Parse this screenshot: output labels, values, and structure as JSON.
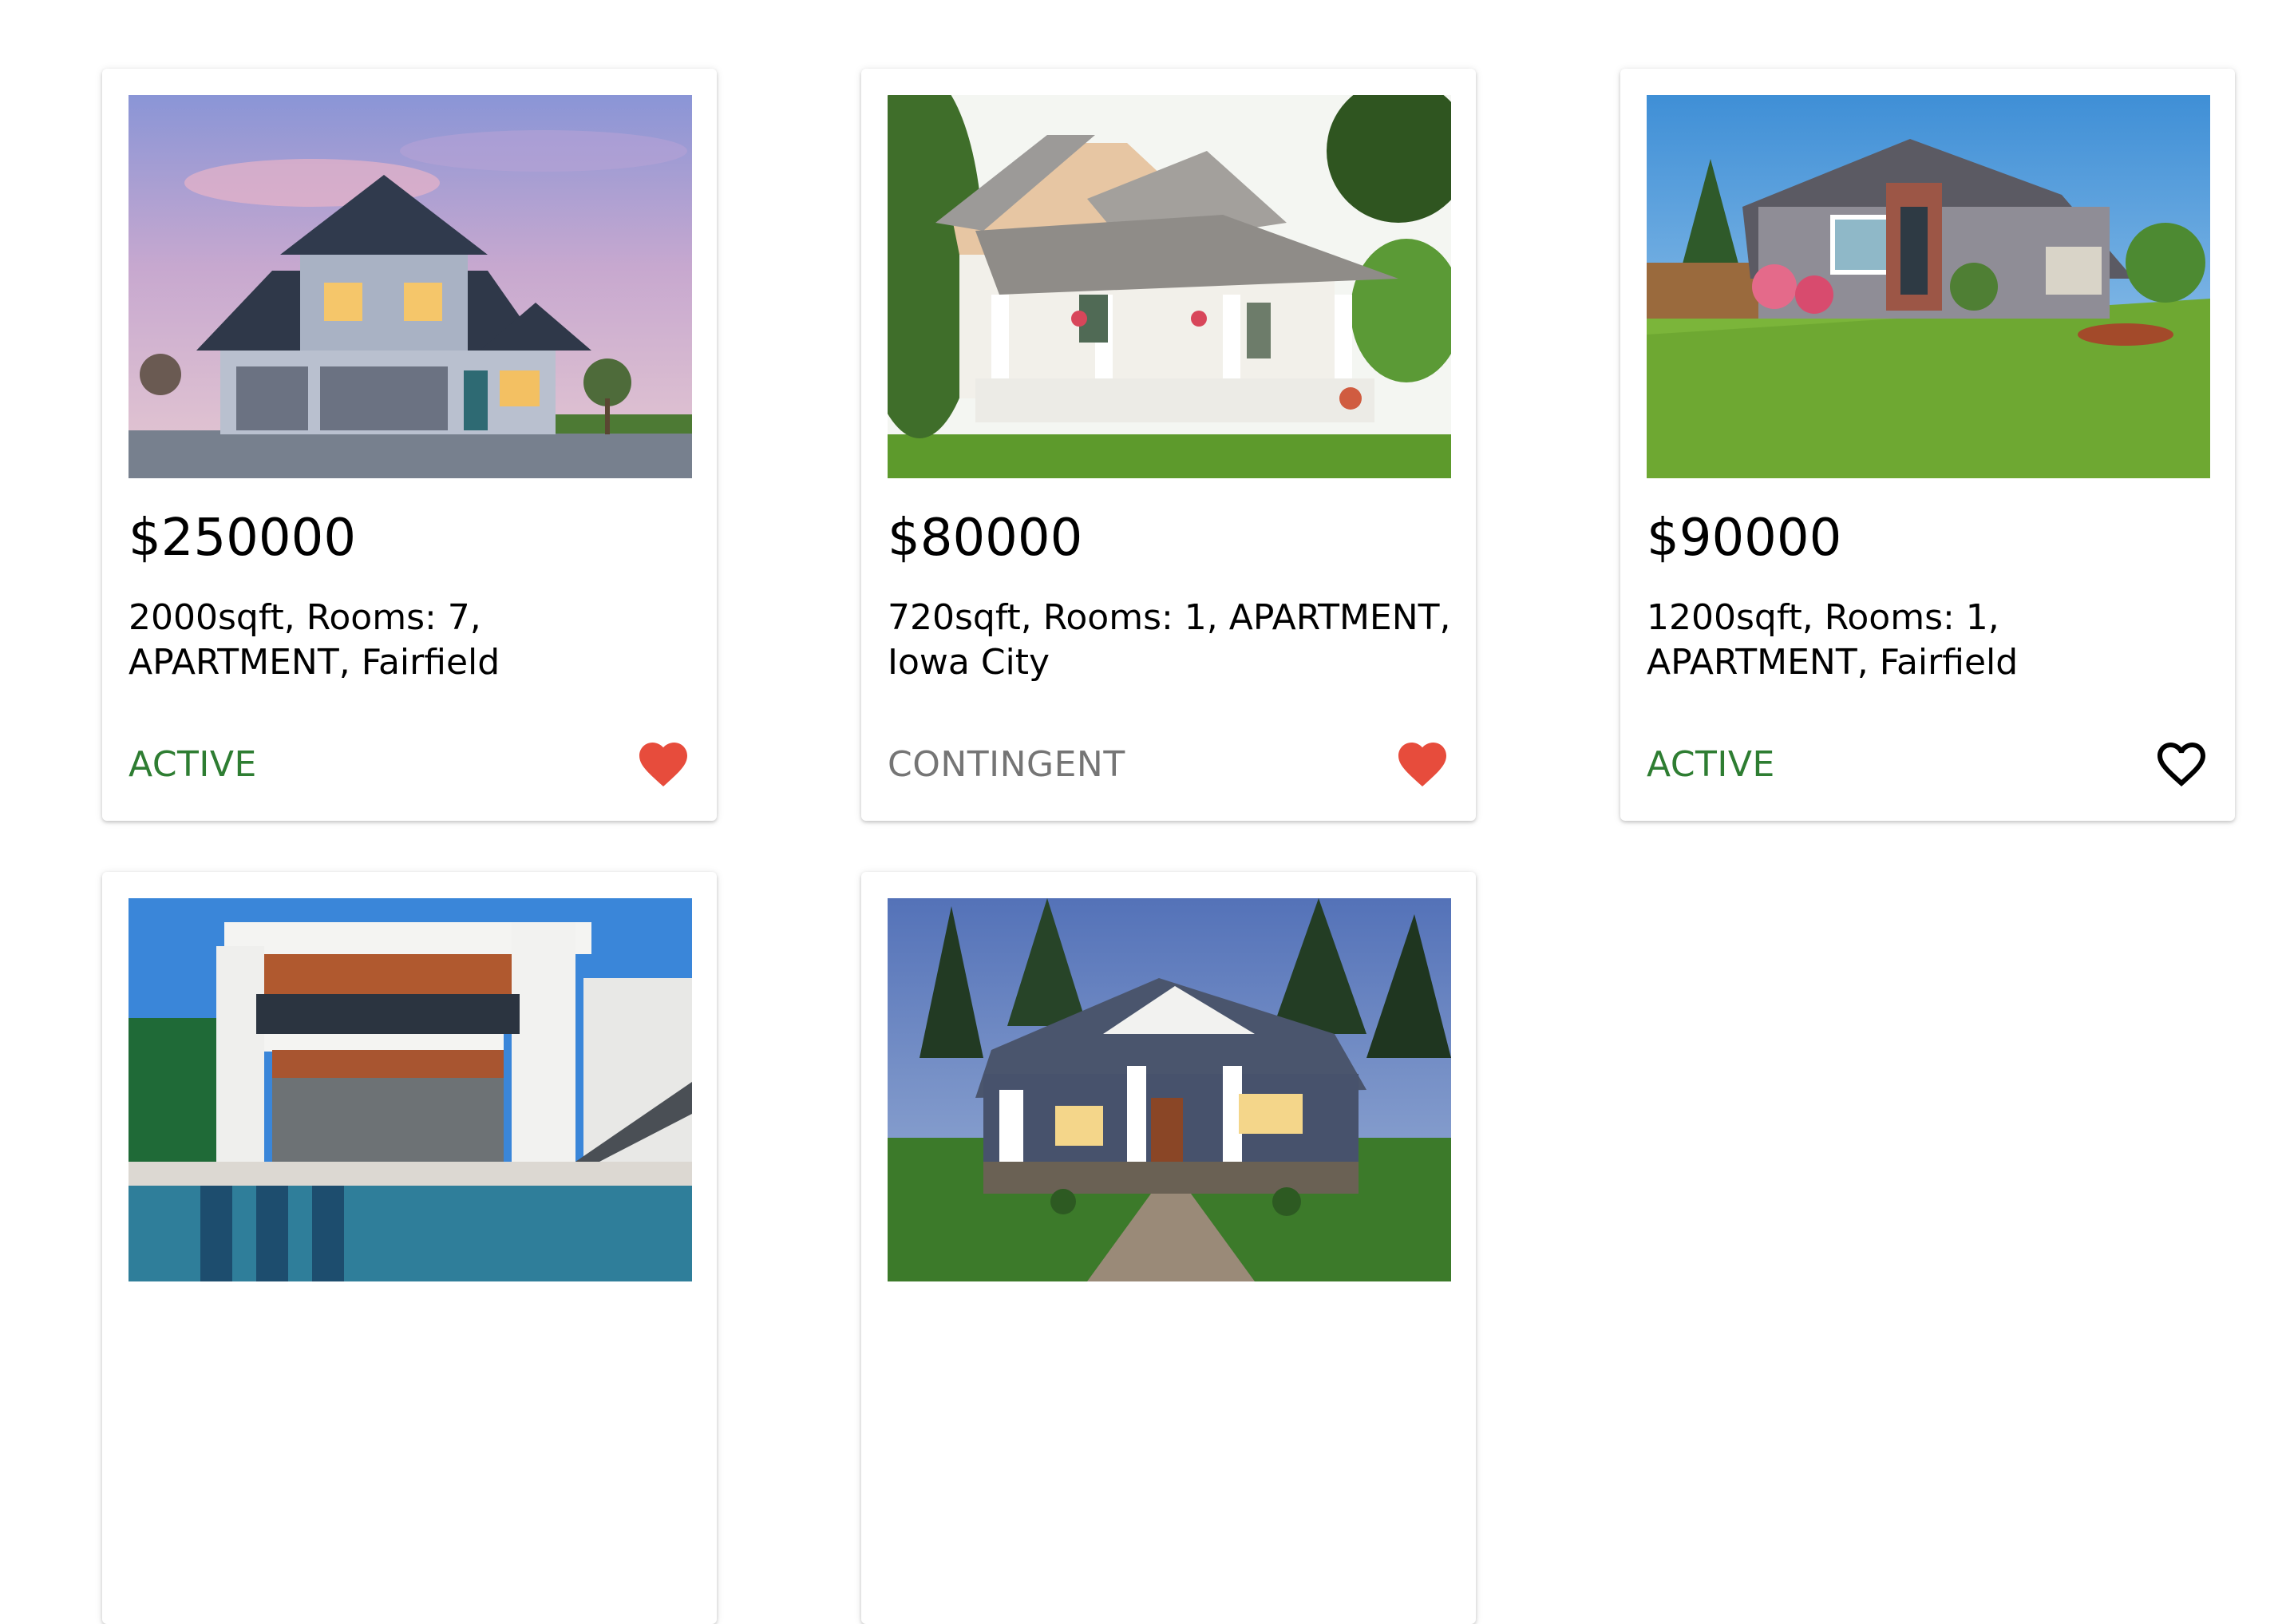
{
  "listings": [
    {
      "price": "$250000",
      "details": "2000sqft, Rooms: 7, APARTMENT, Fairfield",
      "status": "ACTIVE",
      "status_color": "#2e7d32",
      "favorite": true,
      "image": "two-story blue craftsman house at dusk"
    },
    {
      "price": "$80000",
      "details": "720sqft, Rooms: 1, APARTMENT, Iowa City",
      "status": "CONTINGENT",
      "status_color": "#757575",
      "favorite": true,
      "image": "cedar-shingle house with white porch"
    },
    {
      "price": "$90000",
      "details": "1200sqft, Rooms: 1, APARTMENT, Fairfield",
      "status": "ACTIVE",
      "status_color": "#2e7d32",
      "favorite": false,
      "image": "suburban house with large green lawn"
    },
    {
      "image": "modern white villa with pool"
    },
    {
      "image": "craftsman bungalow with stone walkway"
    }
  ],
  "colors": {
    "favorite_active": "#e74c3c",
    "favorite_outline": "#000000"
  }
}
